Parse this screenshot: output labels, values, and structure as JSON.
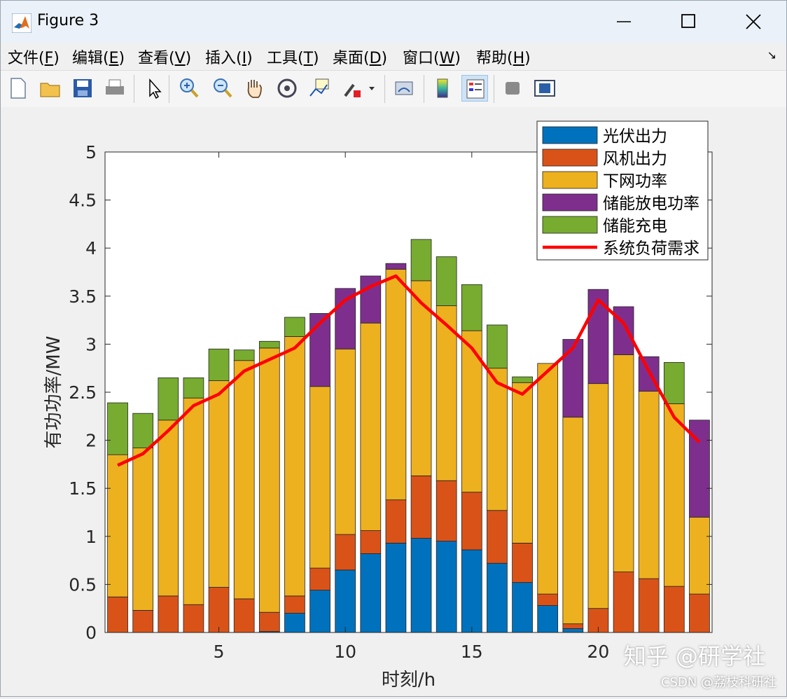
{
  "window": {
    "title": "Figure 3"
  },
  "menu": [
    {
      "text": "文件(",
      "key": "F",
      "end": ")"
    },
    {
      "text": "编辑(",
      "key": "E",
      "end": ")"
    },
    {
      "text": "查看(",
      "key": "V",
      "end": ")"
    },
    {
      "text": "插入(",
      "key": "I",
      "end": ")"
    },
    {
      "text": "工具(",
      "key": "T",
      "end": ")"
    },
    {
      "text": "桌面(",
      "key": "D",
      "end": ")"
    },
    {
      "text": "窗口(",
      "key": "W",
      "end": ")"
    },
    {
      "text": "帮助(",
      "key": "H",
      "end": ")"
    }
  ],
  "toolbar": {
    "icons": [
      "new-figure-icon",
      "open-file-icon",
      "save-icon",
      "print-icon",
      "pointer-icon",
      "zoom-in-icon",
      "zoom-out-icon",
      "pan-hand-icon",
      "rotate-3d-icon",
      "data-cursor-icon",
      "brush-icon",
      "link-plot-icon",
      "colorbar-icon",
      "legend-icon",
      "hide-plot-tools-icon",
      "show-plot-tools-icon"
    ]
  },
  "watermark": {
    "main": "知乎 @研学社",
    "sub": "CSDN @荔枝科研社"
  },
  "chart_data": {
    "type": "bar",
    "stacked": true,
    "xlabel": "时刻/h",
    "ylabel": "有功功率/MW",
    "xlim": [
      0.5,
      24.5
    ],
    "ylim": [
      0,
      5
    ],
    "xticks": [
      5,
      10,
      15,
      20
    ],
    "yticks": [
      0,
      0.5,
      1,
      1.5,
      2,
      2.5,
      3,
      3.5,
      4,
      4.5,
      5
    ],
    "grid": false,
    "legend_position": "top-right",
    "x": [
      1,
      2,
      3,
      4,
      5,
      6,
      7,
      8,
      9,
      10,
      11,
      12,
      13,
      14,
      15,
      16,
      17,
      18,
      19,
      20,
      21,
      22,
      23,
      24
    ],
    "series": [
      {
        "name": "光伏出力",
        "color": "#0072BD",
        "values": [
          0,
          0,
          0,
          0,
          0,
          0,
          0.01,
          0.2,
          0.44,
          0.65,
          0.82,
          0.93,
          0.98,
          0.95,
          0.86,
          0.72,
          0.52,
          0.28,
          0.04,
          0,
          0,
          0,
          0,
          0
        ]
      },
      {
        "name": "风机出力",
        "color": "#D95319",
        "values": [
          0.37,
          0.23,
          0.38,
          0.29,
          0.47,
          0.35,
          0.2,
          0.18,
          0.23,
          0.37,
          0.24,
          0.45,
          0.65,
          0.63,
          0.6,
          0.55,
          0.41,
          0.12,
          0.05,
          0.25,
          0.63,
          0.56,
          0.48,
          0.4
        ]
      },
      {
        "name": "下网功率",
        "color": "#EDB120",
        "values": [
          1.48,
          1.69,
          1.83,
          2.15,
          2.15,
          2.48,
          2.75,
          2.7,
          1.89,
          1.93,
          2.16,
          2.4,
          2.03,
          1.82,
          1.68,
          1.48,
          1.67,
          2.4,
          2.15,
          2.34,
          2.26,
          1.95,
          1.9,
          0.8
        ]
      },
      {
        "name": "储能放电功率",
        "color": "#7E2F8E",
        "values": [
          0,
          0,
          0,
          0,
          0,
          0,
          0,
          0,
          0.76,
          0.63,
          0.49,
          0.06,
          0,
          0,
          0,
          0,
          0,
          0,
          0.81,
          0.98,
          0.5,
          0.36,
          0,
          1.01
        ]
      },
      {
        "name": "储能充电",
        "color": "#77AC30",
        "values": [
          0.54,
          0.36,
          0.44,
          0.21,
          0.33,
          0.11,
          0.07,
          0.2,
          0,
          0,
          0,
          0,
          0.43,
          0.51,
          0.48,
          0.45,
          0.06,
          0,
          0,
          0,
          0,
          0,
          0.43,
          0
        ]
      },
      {
        "name": "系统负荷需求",
        "color": "#FF0000",
        "type": "line",
        "values": [
          1.74,
          1.86,
          2.1,
          2.36,
          2.48,
          2.72,
          2.84,
          2.96,
          3.22,
          3.46,
          3.6,
          3.71,
          3.43,
          3.2,
          2.96,
          2.6,
          2.48,
          2.72,
          2.96,
          3.46,
          3.22,
          2.72,
          2.24,
          1.98
        ]
      }
    ]
  }
}
